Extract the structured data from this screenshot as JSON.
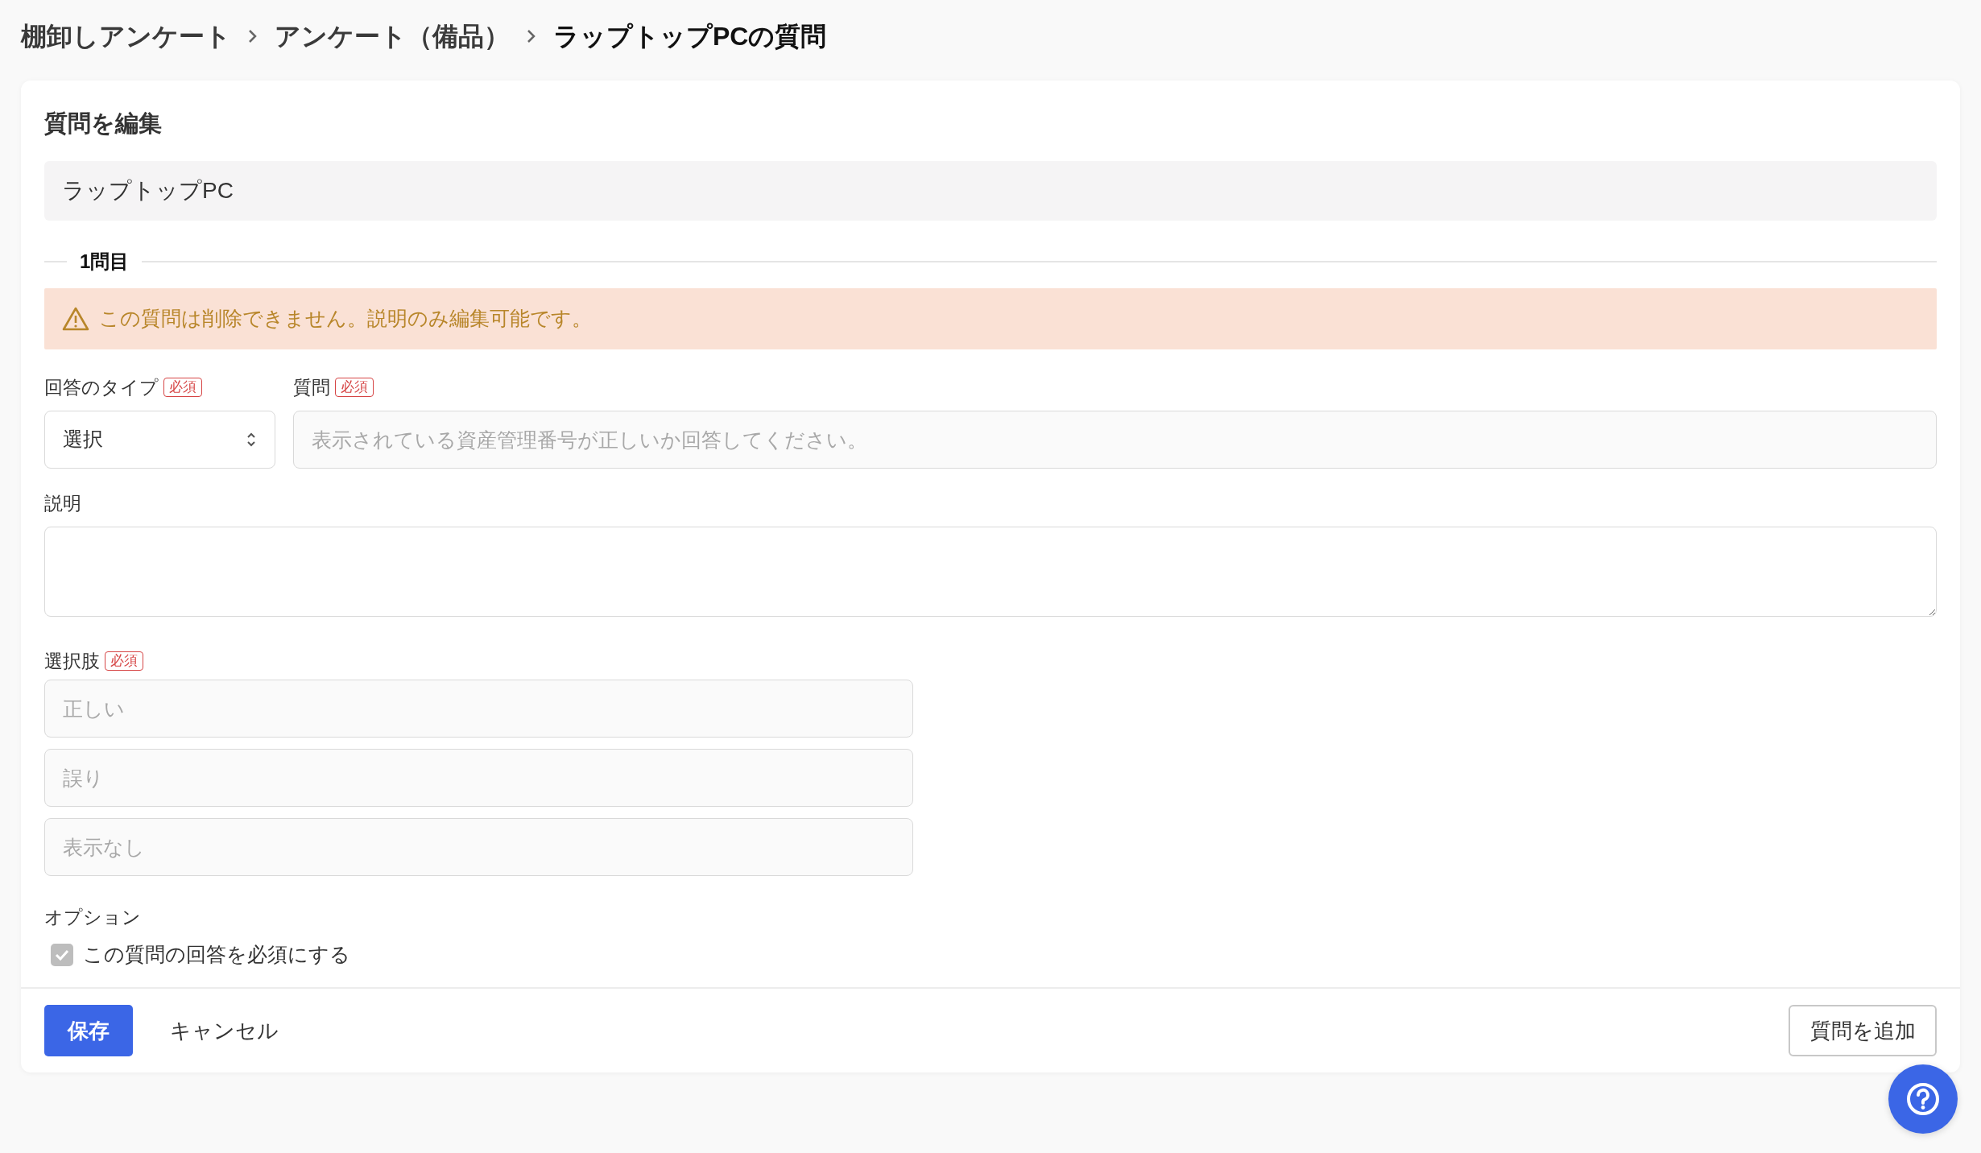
{
  "breadcrumb": [
    {
      "label": "棚卸しアンケート",
      "current": false
    },
    {
      "label": "アンケート（備品）",
      "current": false
    },
    {
      "label": "ラップトップPCの質問",
      "current": true
    }
  ],
  "card": {
    "title": "質問を編集",
    "name_field": {
      "value": "ラップトップPC"
    },
    "section_label": "1問目",
    "alert": {
      "text": "この質問は削除できません。説明のみ編集可能です。"
    },
    "answer_type": {
      "label": "回答のタイプ",
      "required_badge": "必須",
      "value": "選択",
      "disabled": false
    },
    "question": {
      "label": "質問",
      "required_badge": "必須",
      "value": "表示されている資産管理番号が正しいか回答してください。",
      "disabled": true
    },
    "description": {
      "label": "説明"
    },
    "choices": {
      "label": "選択肢",
      "required_badge": "必須",
      "items": [
        {
          "value": "正しい",
          "disabled": true
        },
        {
          "value": "誤り",
          "disabled": true
        },
        {
          "value": "表示なし",
          "disabled": true
        }
      ]
    },
    "options": {
      "label": "オプション",
      "items": [
        {
          "label": "この質問の回答を必須にする",
          "checked": true,
          "disabled": true
        }
      ]
    },
    "footer": {
      "save": "保存",
      "cancel": "キャンセル",
      "add_question": "質問を追加"
    }
  }
}
